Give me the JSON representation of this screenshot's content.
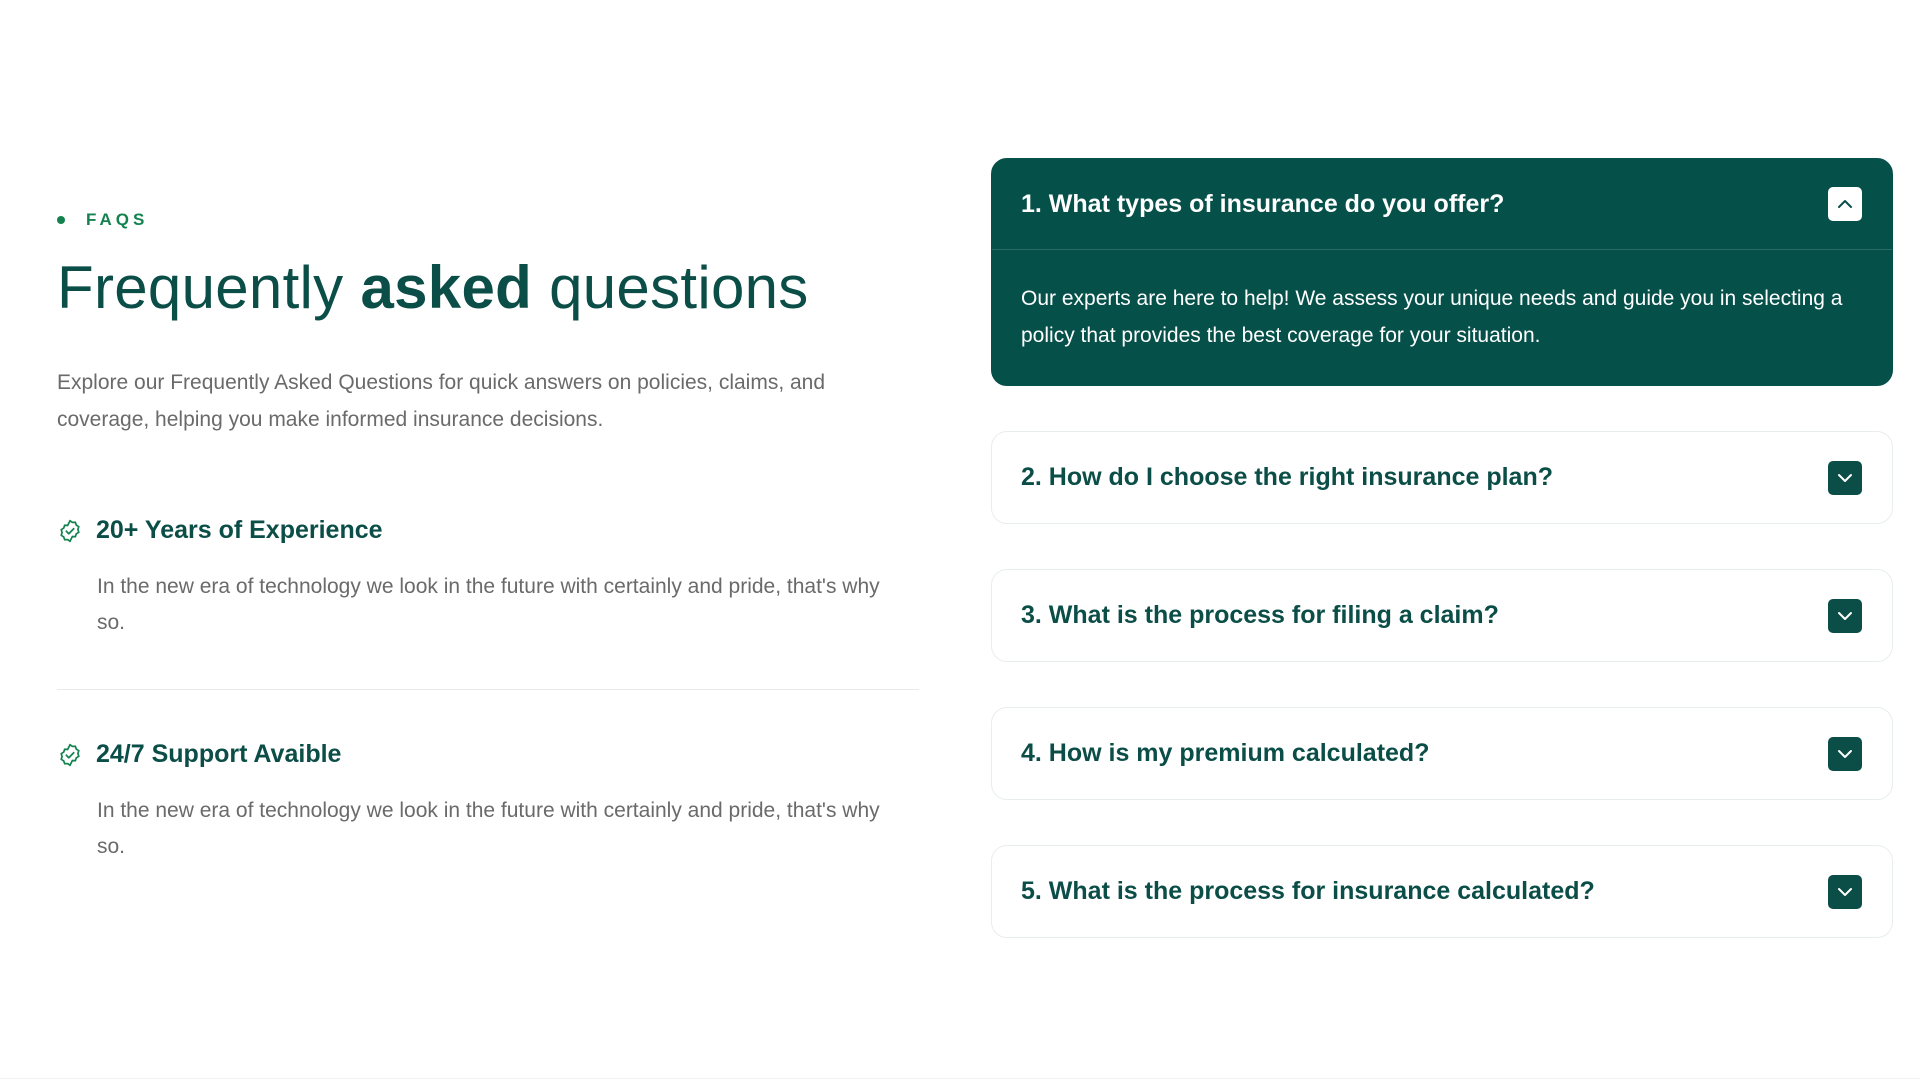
{
  "section": {
    "eyebrow": "FAQS",
    "heading_pre": "Frequently ",
    "heading_bold": "asked",
    "heading_post": " questions",
    "intro": "Explore our Frequently Asked Questions for quick answers on policies, claims, and coverage, helping you make informed insurance decisions."
  },
  "features": [
    {
      "title": "20+ Years of Experience",
      "text": "In the new era of technology we look in the future with certainly and pride, that's why so.",
      "icon": "badge-check-icon"
    },
    {
      "title": "24/7 Support Avaible",
      "text": "In the new era of technology we look in the future with certainly and pride, that's why so.",
      "icon": "badge-check-icon"
    }
  ],
  "faq": [
    {
      "question": "1. What types of insurance do you offer?",
      "answer": "Our experts are here to help! We assess your unique needs and guide you in selecting a policy that provides the best coverage for your situation.",
      "open": true,
      "icon": "chevron-up-icon"
    },
    {
      "question": "2. How do I choose the right insurance plan?",
      "open": false,
      "icon": "chevron-down-icon"
    },
    {
      "question": "3. What is the process for filing a claim?",
      "open": false,
      "icon": "chevron-down-icon"
    },
    {
      "question": "4. How is my premium calculated?",
      "open": false,
      "icon": "chevron-down-icon"
    },
    {
      "question": "5. What is the process for insurance calculated?",
      "open": false,
      "icon": "chevron-down-icon"
    }
  ],
  "colors": {
    "primary": "#0b4d47",
    "open_panel": "#06504a",
    "accent": "#13824f",
    "body_text": "#6a6a6a"
  }
}
